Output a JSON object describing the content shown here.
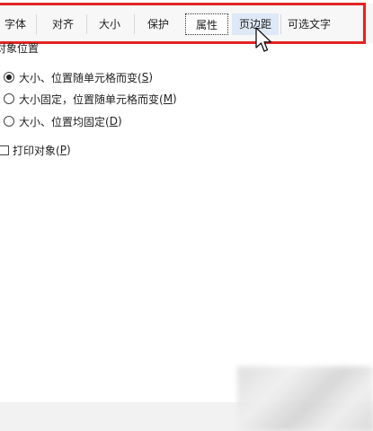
{
  "tabs": [
    {
      "label": "字体"
    },
    {
      "label": "对齐"
    },
    {
      "label": "大小"
    },
    {
      "label": "保护"
    },
    {
      "label": "属性",
      "active": true
    },
    {
      "label": "页边距",
      "hovered": true
    },
    {
      "label": "可选文字"
    }
  ],
  "section": {
    "title": "对象位置"
  },
  "options": [
    {
      "label": "大小、位置随单元格而变(",
      "key": "S",
      "suffix": ")",
      "checked": true
    },
    {
      "label": "大小固定，位置随单元格而变(",
      "key": "M",
      "suffix": ")",
      "checked": false
    },
    {
      "label": "大小、位置均固定(",
      "key": "D",
      "suffix": ")",
      "checked": false
    }
  ],
  "print_object": {
    "label": "打印对象(",
    "key": "P",
    "suffix": ")",
    "checked": false
  },
  "colors": {
    "highlight": "#e32424",
    "hover_tab": "#dde9f6"
  },
  "icons": {
    "cursor": "arrow-pointer-icon"
  }
}
